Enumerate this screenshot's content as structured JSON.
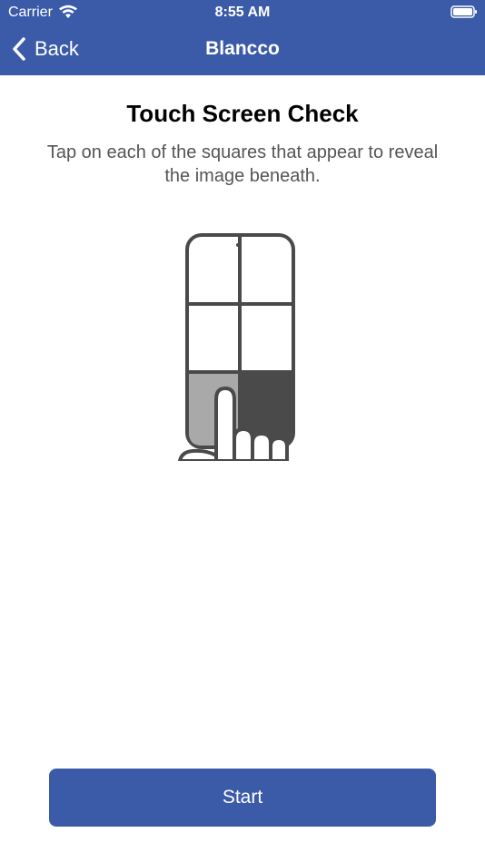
{
  "status_bar": {
    "carrier": "Carrier",
    "time": "8:55 AM",
    "wifi_icon": "wifi-icon",
    "battery_icon": "battery-icon"
  },
  "nav": {
    "back_label": "Back",
    "title": "Blancco",
    "back_icon": "chevron-left-icon"
  },
  "main": {
    "title": "Touch Screen Check",
    "subtitle": "Tap on each of the squares that appear to reveal the image beneath.",
    "illustration_icon": "phone-grid-tap-icon"
  },
  "footer": {
    "start_label": "Start"
  },
  "colors": {
    "accent": "#3b5ba9",
    "text_secondary": "#555555",
    "illustration_dark": "#4a4a4a",
    "illustration_light": "#a9a9a9"
  }
}
